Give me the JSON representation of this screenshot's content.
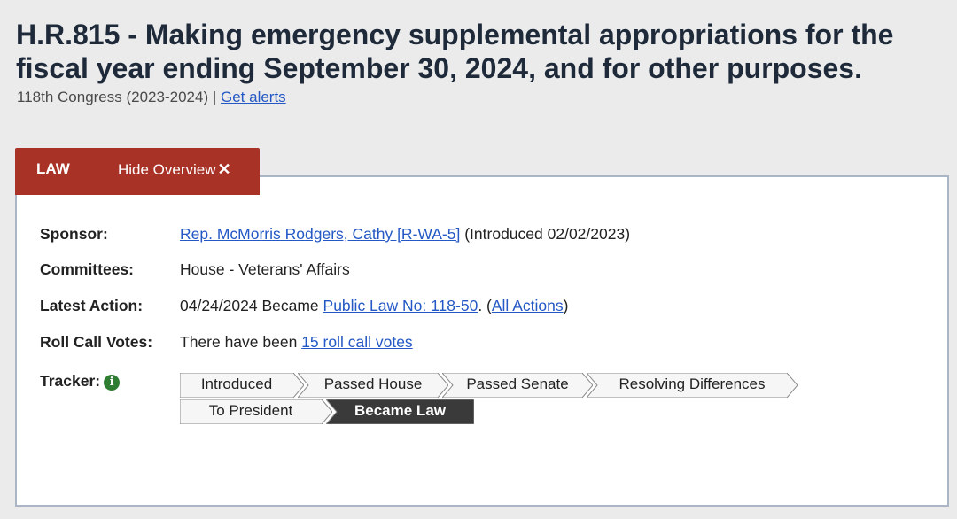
{
  "header": {
    "title": "H.R.815 - Making emergency supplemental appropriations for the fiscal year ending September 30, 2024, and for other purposes.",
    "congress": "118th Congress (2023-2024) |",
    "alerts_link": "Get alerts"
  },
  "tabs": {
    "law": "LAW",
    "hide_overview": "Hide Overview",
    "hide_icon": "close-icon"
  },
  "overview": {
    "sponsor_label": "Sponsor:",
    "sponsor_link": "Rep. McMorris Rodgers, Cathy [R-WA-5]",
    "sponsor_note": "(Introduced 02/02/2023)",
    "committees_label": "Committees:",
    "committees_value": "House - Veterans' Affairs",
    "latest_action_label": "Latest Action:",
    "latest_action_text": "04/24/2024 Became",
    "latest_action_link": "Public Law No: 118-50",
    "latest_action_sep": ".  (",
    "all_actions_link": "All Actions",
    "latest_action_close": ")",
    "roll_call_label": "Roll Call Votes:",
    "roll_call_text": "There have been",
    "roll_call_link": "15 roll call votes",
    "tracker_label": "Tracker:",
    "tracker_info_icon": "info-icon"
  },
  "tracker": {
    "steps": [
      "Introduced",
      "Passed House",
      "Passed Senate",
      "Resolving Differences",
      "To President",
      "Became Law"
    ],
    "current_step": "Became Law",
    "colors": {
      "active_bg": "#3a3a3a",
      "active_text": "#ffffff",
      "inactive_bg": "#f6f6f6",
      "border": "#8a8a8a"
    }
  },
  "colors": {
    "tab_bg": "#a93226",
    "link": "#2458c5",
    "panel_border": "#aab6c6",
    "page_bg": "#ebebeb"
  }
}
